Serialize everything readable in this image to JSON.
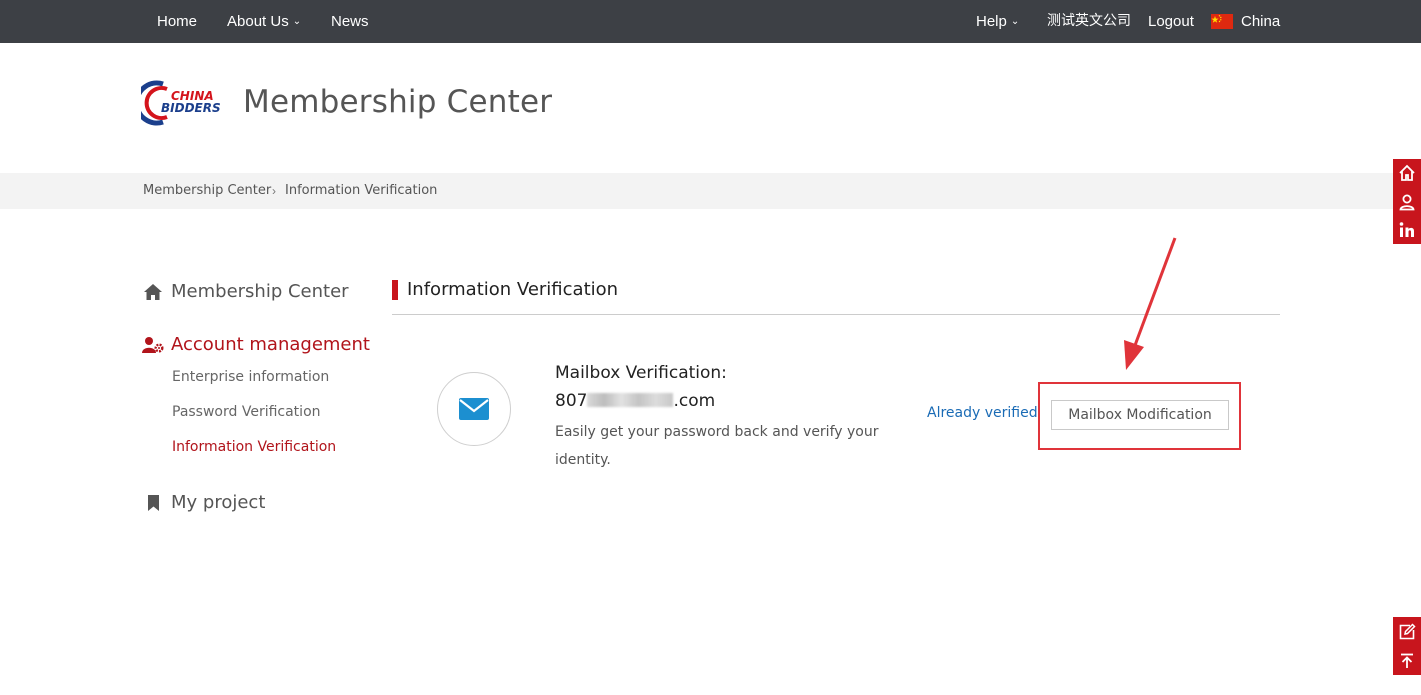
{
  "topnav": {
    "home": "Home",
    "about": "About Us",
    "news": "News",
    "help": "Help",
    "company": "测试英文公司",
    "logout": "Logout",
    "region": "China"
  },
  "header": {
    "logo_text_top": "CHINA",
    "logo_text_bottom": "BIDDERS",
    "title": "Membership Center"
  },
  "breadcrumb": {
    "items": [
      "Membership Center",
      "Information Verification"
    ],
    "separator": "›"
  },
  "sidebar": {
    "membership_center": "Membership Center",
    "account_management": "Account management",
    "sub_items": [
      "Enterprise information",
      "Password Verification",
      "Information Verification"
    ],
    "my_project": "My project"
  },
  "panel": {
    "title": "Information Verification",
    "mailbox_title": "Mailbox Verification:",
    "email_prefix": "807",
    "email_suffix": ".com",
    "description": "Easily get your password back and verify your identity.",
    "status": "Already verified",
    "modify_button": "Mailbox Modification"
  },
  "colors": {
    "topbar": "#3d4045",
    "accent_red": "#c8151d",
    "link_blue": "#1a6bb5",
    "icon_blue": "#1c8fd0"
  },
  "icons": {
    "side_tools": [
      "home-icon",
      "user-icon",
      "linkedin-icon"
    ],
    "side_tools_bottom": [
      "edit-icon",
      "back-to-top-icon"
    ],
    "mail": "envelope-icon"
  }
}
